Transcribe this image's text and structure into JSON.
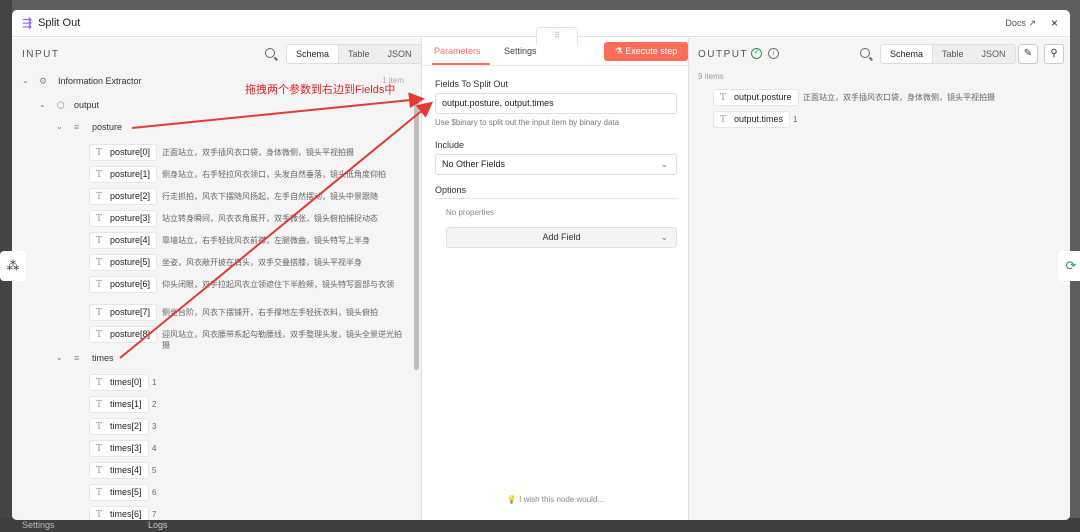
{
  "window": {
    "title": "Split Out",
    "docs_label": "Docs",
    "close_label": "×"
  },
  "input_panel": {
    "title": "INPUT",
    "views": [
      "Schema",
      "Table",
      "JSON"
    ],
    "active_view": "Schema",
    "node_name": "Information Extractor",
    "item_count": "1 item",
    "output_label": "output",
    "posture_label": "posture",
    "times_label": "times",
    "posture_items": [
      {
        "key": "posture[0]",
        "value": "正面站立，双手插风衣口袋，身体微侧，镜头平视拍摄"
      },
      {
        "key": "posture[1]",
        "value": "侧身站立，右手轻拉风衣领口，头发自然垂落，镜头低角度仰拍"
      },
      {
        "key": "posture[2]",
        "value": "行走抓拍，风衣下摆随风扬起，左手自然摆动，镜头中景跟随"
      },
      {
        "key": "posture[3]",
        "value": "站立转身瞬间，风衣衣角展开，双手微张，镜头俯拍捕捉动态"
      },
      {
        "key": "posture[4]",
        "value": "靠墙站立，右手轻拢风衣前襟，左腿微曲，镜头特写上半身"
      },
      {
        "key": "posture[5]",
        "value": "坐姿，风衣敞开披在肩头，双手交叠搭膝，镜头平视半身"
      },
      {
        "key": "posture[6]",
        "value": "仰头闭眼，双手拉起风衣立领遮住下半脸颊，镜头特写面部与衣领"
      },
      {
        "key": "posture[7]",
        "value": "侧坐台阶，风衣下摆铺开，右手撑地左手轻抚衣料，镜头俯拍"
      },
      {
        "key": "posture[8]",
        "value": "迎风站立，风衣腰带系起勾勒腰线，双手整理头发，镜头全景逆光拍摄"
      }
    ],
    "times_items": [
      {
        "key": "times[0]",
        "value": "1"
      },
      {
        "key": "times[1]",
        "value": "2"
      },
      {
        "key": "times[2]",
        "value": "3"
      },
      {
        "key": "times[3]",
        "value": "4"
      },
      {
        "key": "times[4]",
        "value": "5"
      },
      {
        "key": "times[5]",
        "value": "6"
      },
      {
        "key": "times[6]",
        "value": "7"
      }
    ]
  },
  "annotation": "拖拽两个参数到右边到Fields中",
  "params_panel": {
    "tabs": [
      "Parameters",
      "Settings"
    ],
    "active_tab": "Parameters",
    "execute_label": "Execute step",
    "fields_label": "Fields To Split Out",
    "fields_value": "output.posture, output.times",
    "fields_hint": "Use $binary to split out the input item by binary data",
    "include_label": "Include",
    "include_value": "No Other Fields",
    "options_label": "Options",
    "no_properties": "No properties",
    "add_field_label": "Add Field",
    "wish_text": "I wish this node would..."
  },
  "output_panel": {
    "title": "OUTPUT",
    "views": [
      "Schema",
      "Table",
      "JSON"
    ],
    "active_view": "Schema",
    "item_count": "9 items",
    "fields": [
      {
        "key": "output.posture",
        "value": "正面站立，双手插风衣口袋，身体微侧，镜头平视拍摄"
      },
      {
        "key": "output.times",
        "value": "1"
      }
    ]
  },
  "background": {
    "settings_label": "Settings",
    "logs_label": "Logs"
  },
  "colors": {
    "accent": "#ff6d5a",
    "success": "#1f9d55",
    "annotation": "#e02424"
  }
}
